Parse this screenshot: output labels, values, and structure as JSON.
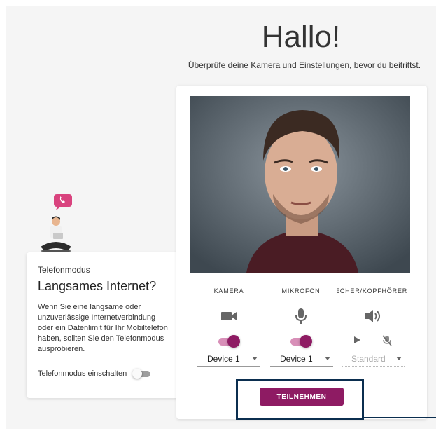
{
  "header": {
    "title": "Hallo!",
    "subtitle": "Überprüfe deine Kamera und Einstellungen, bevor du beitrittst."
  },
  "phone_mode": {
    "overline": "Telefonmodus",
    "heading": "Langsames Internet?",
    "description": "Wenn Sie eine langsame oder unzuverlässige Internetverbindung oder ein Datenlimit für Ihr Mobiltelefon haben, sollten Sie den Telefonmodus ausprobieren.",
    "toggle_label": "Telefonmodus einschalten",
    "toggle_on": false
  },
  "devices": {
    "camera": {
      "label": "KAMERA",
      "icon": "video-camera-icon",
      "enabled": true,
      "selected": "Device 1"
    },
    "microphone": {
      "label": "MIKROFON",
      "icon": "microphone-icon",
      "enabled": true,
      "selected": "Device 1"
    },
    "speaker": {
      "label": "LAUTSPRECHER/KOPFHÖRER",
      "icon": "speaker-icon",
      "selected": "Standard",
      "controls": [
        "play-icon",
        "mute-mic-icon"
      ]
    }
  },
  "join_button": {
    "label": "TEILNEHMEN"
  },
  "colors": {
    "accent": "#8e1b63",
    "highlight": "#0b2e4f",
    "background": "#f5f5f5"
  }
}
